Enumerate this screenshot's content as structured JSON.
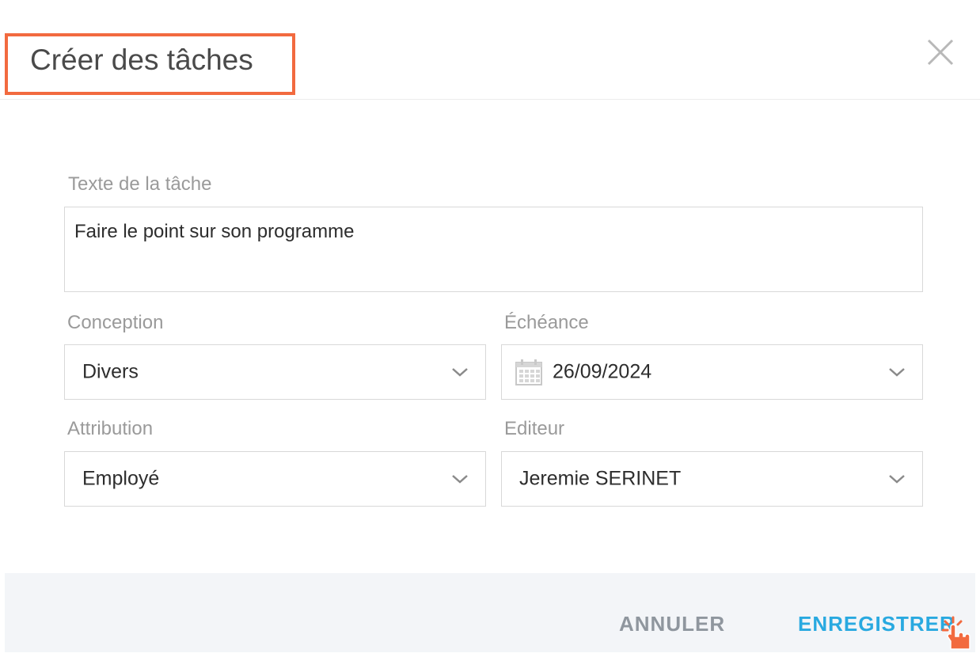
{
  "dialog": {
    "title": "Créer des tâches",
    "close_icon": "close-icon"
  },
  "task_text": {
    "label": "Texte de la tâche",
    "value": "Faire le point sur son programme"
  },
  "conception": {
    "label": "Conception",
    "value": "Divers"
  },
  "echeance": {
    "label": "Échéance",
    "value": "26/09/2024",
    "icon": "calendar-icon"
  },
  "attribution": {
    "label": "Attribution",
    "value": "Employé"
  },
  "editeur": {
    "label": "Editeur",
    "value": "Jeremie SERINET"
  },
  "footer": {
    "cancel_label": "ANNULER",
    "save_label": "ENREGISTRER"
  },
  "colors": {
    "highlight_border": "#f26a3f",
    "save_button": "#29a9e0",
    "cancel_button": "#8f969e",
    "footer_bg": "#f3f5f8"
  }
}
